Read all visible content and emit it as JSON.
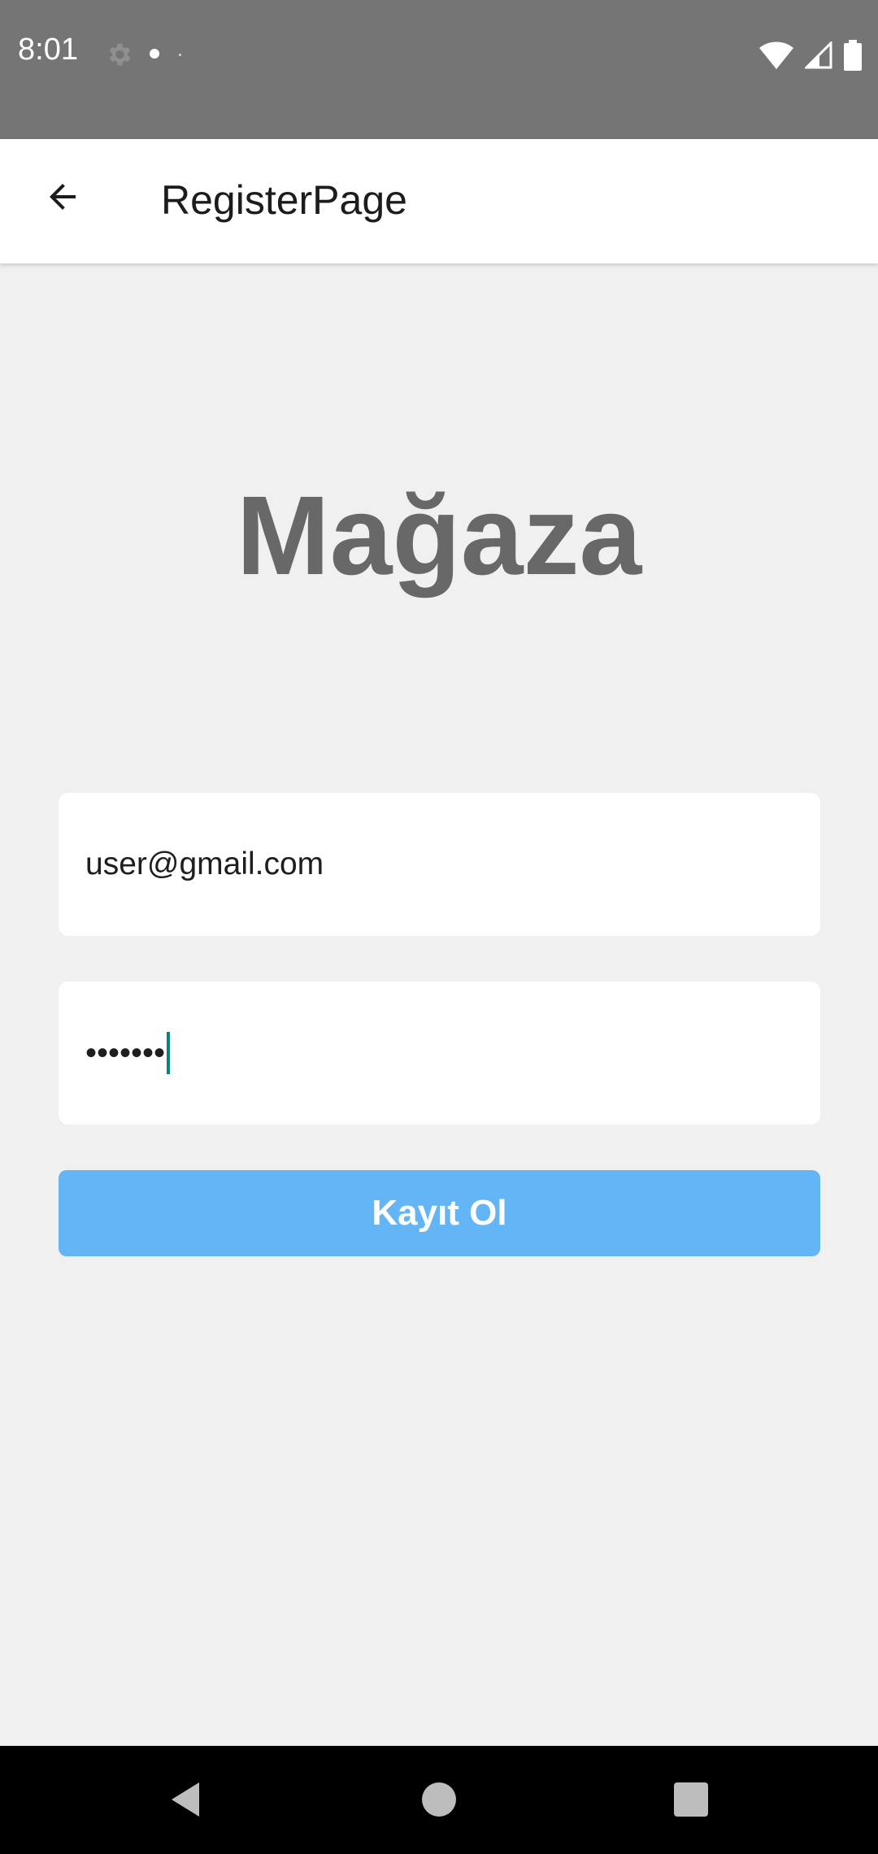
{
  "status_bar": {
    "time": "8:01",
    "icons": [
      "settings-icon",
      "notification-dot",
      "wifi-icon",
      "signal-icon",
      "battery-icon"
    ]
  },
  "app_bar": {
    "title": "RegisterPage",
    "back_icon": "arrow-back-icon"
  },
  "brand": {
    "title": "Mağaza"
  },
  "form": {
    "email_value": "user@gmail.com",
    "password_value": "•••••••",
    "submit_label": "Kayıt Ol"
  },
  "colors": {
    "status_bar": "#757575",
    "background": "#f0f0f1",
    "button": "#64b5f6",
    "cursor": "#00897b",
    "brand_text": "#686868"
  },
  "nav_bar": {
    "icons": [
      "nav-back-icon",
      "nav-home-icon",
      "nav-recents-icon"
    ]
  }
}
